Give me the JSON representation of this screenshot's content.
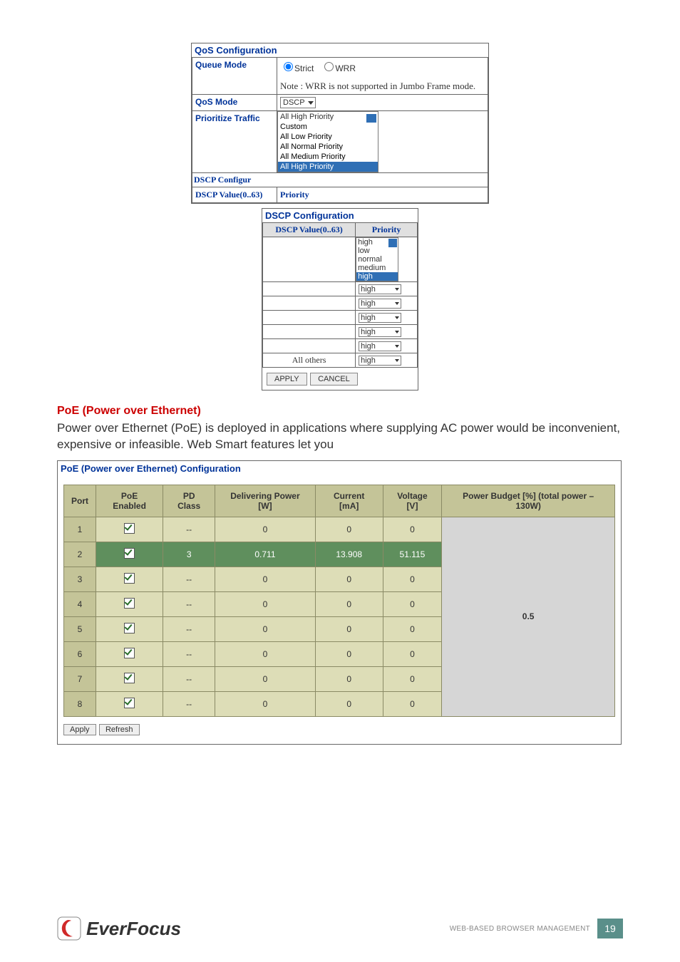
{
  "qos": {
    "panel_title": "QoS Configuration",
    "rows": {
      "queue_mode_label": "Queue Mode",
      "radio_strict": "Strict",
      "radio_wrr": "WRR",
      "note": "Note : WRR is not supported in Jumbo Frame mode.",
      "qos_mode_label": "QoS Mode",
      "qos_mode_value": "DSCP",
      "prioritize_label": "Prioritize Traffic",
      "prioritize_value": "All High Priority",
      "prioritize_options": [
        "Custom",
        "All Low Priority",
        "All Normal Priority",
        "All Medium Priority",
        "All High Priority"
      ],
      "dscp_configur_label": "DSCP Configur",
      "dscp_value_label": "DSCP Value(0..63)",
      "priority_label": "Priority"
    }
  },
  "dscp": {
    "panel_title": "DSCP Configuration",
    "col1": "DSCP Value(0..63)",
    "col2": "Priority",
    "open_select": {
      "top": "high",
      "options": [
        "low",
        "normal",
        "medium",
        "high"
      ]
    },
    "rows_high_count": 5,
    "high_label": "high",
    "all_others": "All others",
    "btn_apply": "APPLY",
    "btn_cancel": "CANCEL"
  },
  "section": {
    "heading": "PoE (Power over Ethernet)",
    "body": "Power over Ethernet (PoE) is deployed in applications where supplying AC power would be inconvenient, expensive or infeasible. Web Smart features let you"
  },
  "poe": {
    "title": "PoE (Power over Ethernet) Configuration",
    "headers": [
      "Port",
      "PoE Enabled",
      "PD Class",
      "Delivering Power [W]",
      "Current [mA]",
      "Voltage [V]",
      "Power Budget [%] (total power – 130W)"
    ],
    "rows": [
      {
        "port": "1",
        "enabled": true,
        "pdclass": "--",
        "power": "0",
        "current": "0",
        "voltage": "0"
      },
      {
        "port": "2",
        "enabled": true,
        "pdclass": "3",
        "power": "0.711",
        "current": "13.908",
        "voltage": "51.115",
        "active": true
      },
      {
        "port": "3",
        "enabled": true,
        "pdclass": "--",
        "power": "0",
        "current": "0",
        "voltage": "0"
      },
      {
        "port": "4",
        "enabled": true,
        "pdclass": "--",
        "power": "0",
        "current": "0",
        "voltage": "0"
      },
      {
        "port": "5",
        "enabled": true,
        "pdclass": "--",
        "power": "0",
        "current": "0",
        "voltage": "0"
      },
      {
        "port": "6",
        "enabled": true,
        "pdclass": "--",
        "power": "0",
        "current": "0",
        "voltage": "0"
      },
      {
        "port": "7",
        "enabled": true,
        "pdclass": "--",
        "power": "0",
        "current": "0",
        "voltage": "0"
      },
      {
        "port": "8",
        "enabled": true,
        "pdclass": "--",
        "power": "0",
        "current": "0",
        "voltage": "0"
      }
    ],
    "budget": "0.5",
    "btn_apply": "Apply",
    "btn_refresh": "Refresh"
  },
  "footer": {
    "brand": "EverFocus",
    "label": "WEB-BASED BROWSER MANAGEMENT",
    "page": "19"
  }
}
